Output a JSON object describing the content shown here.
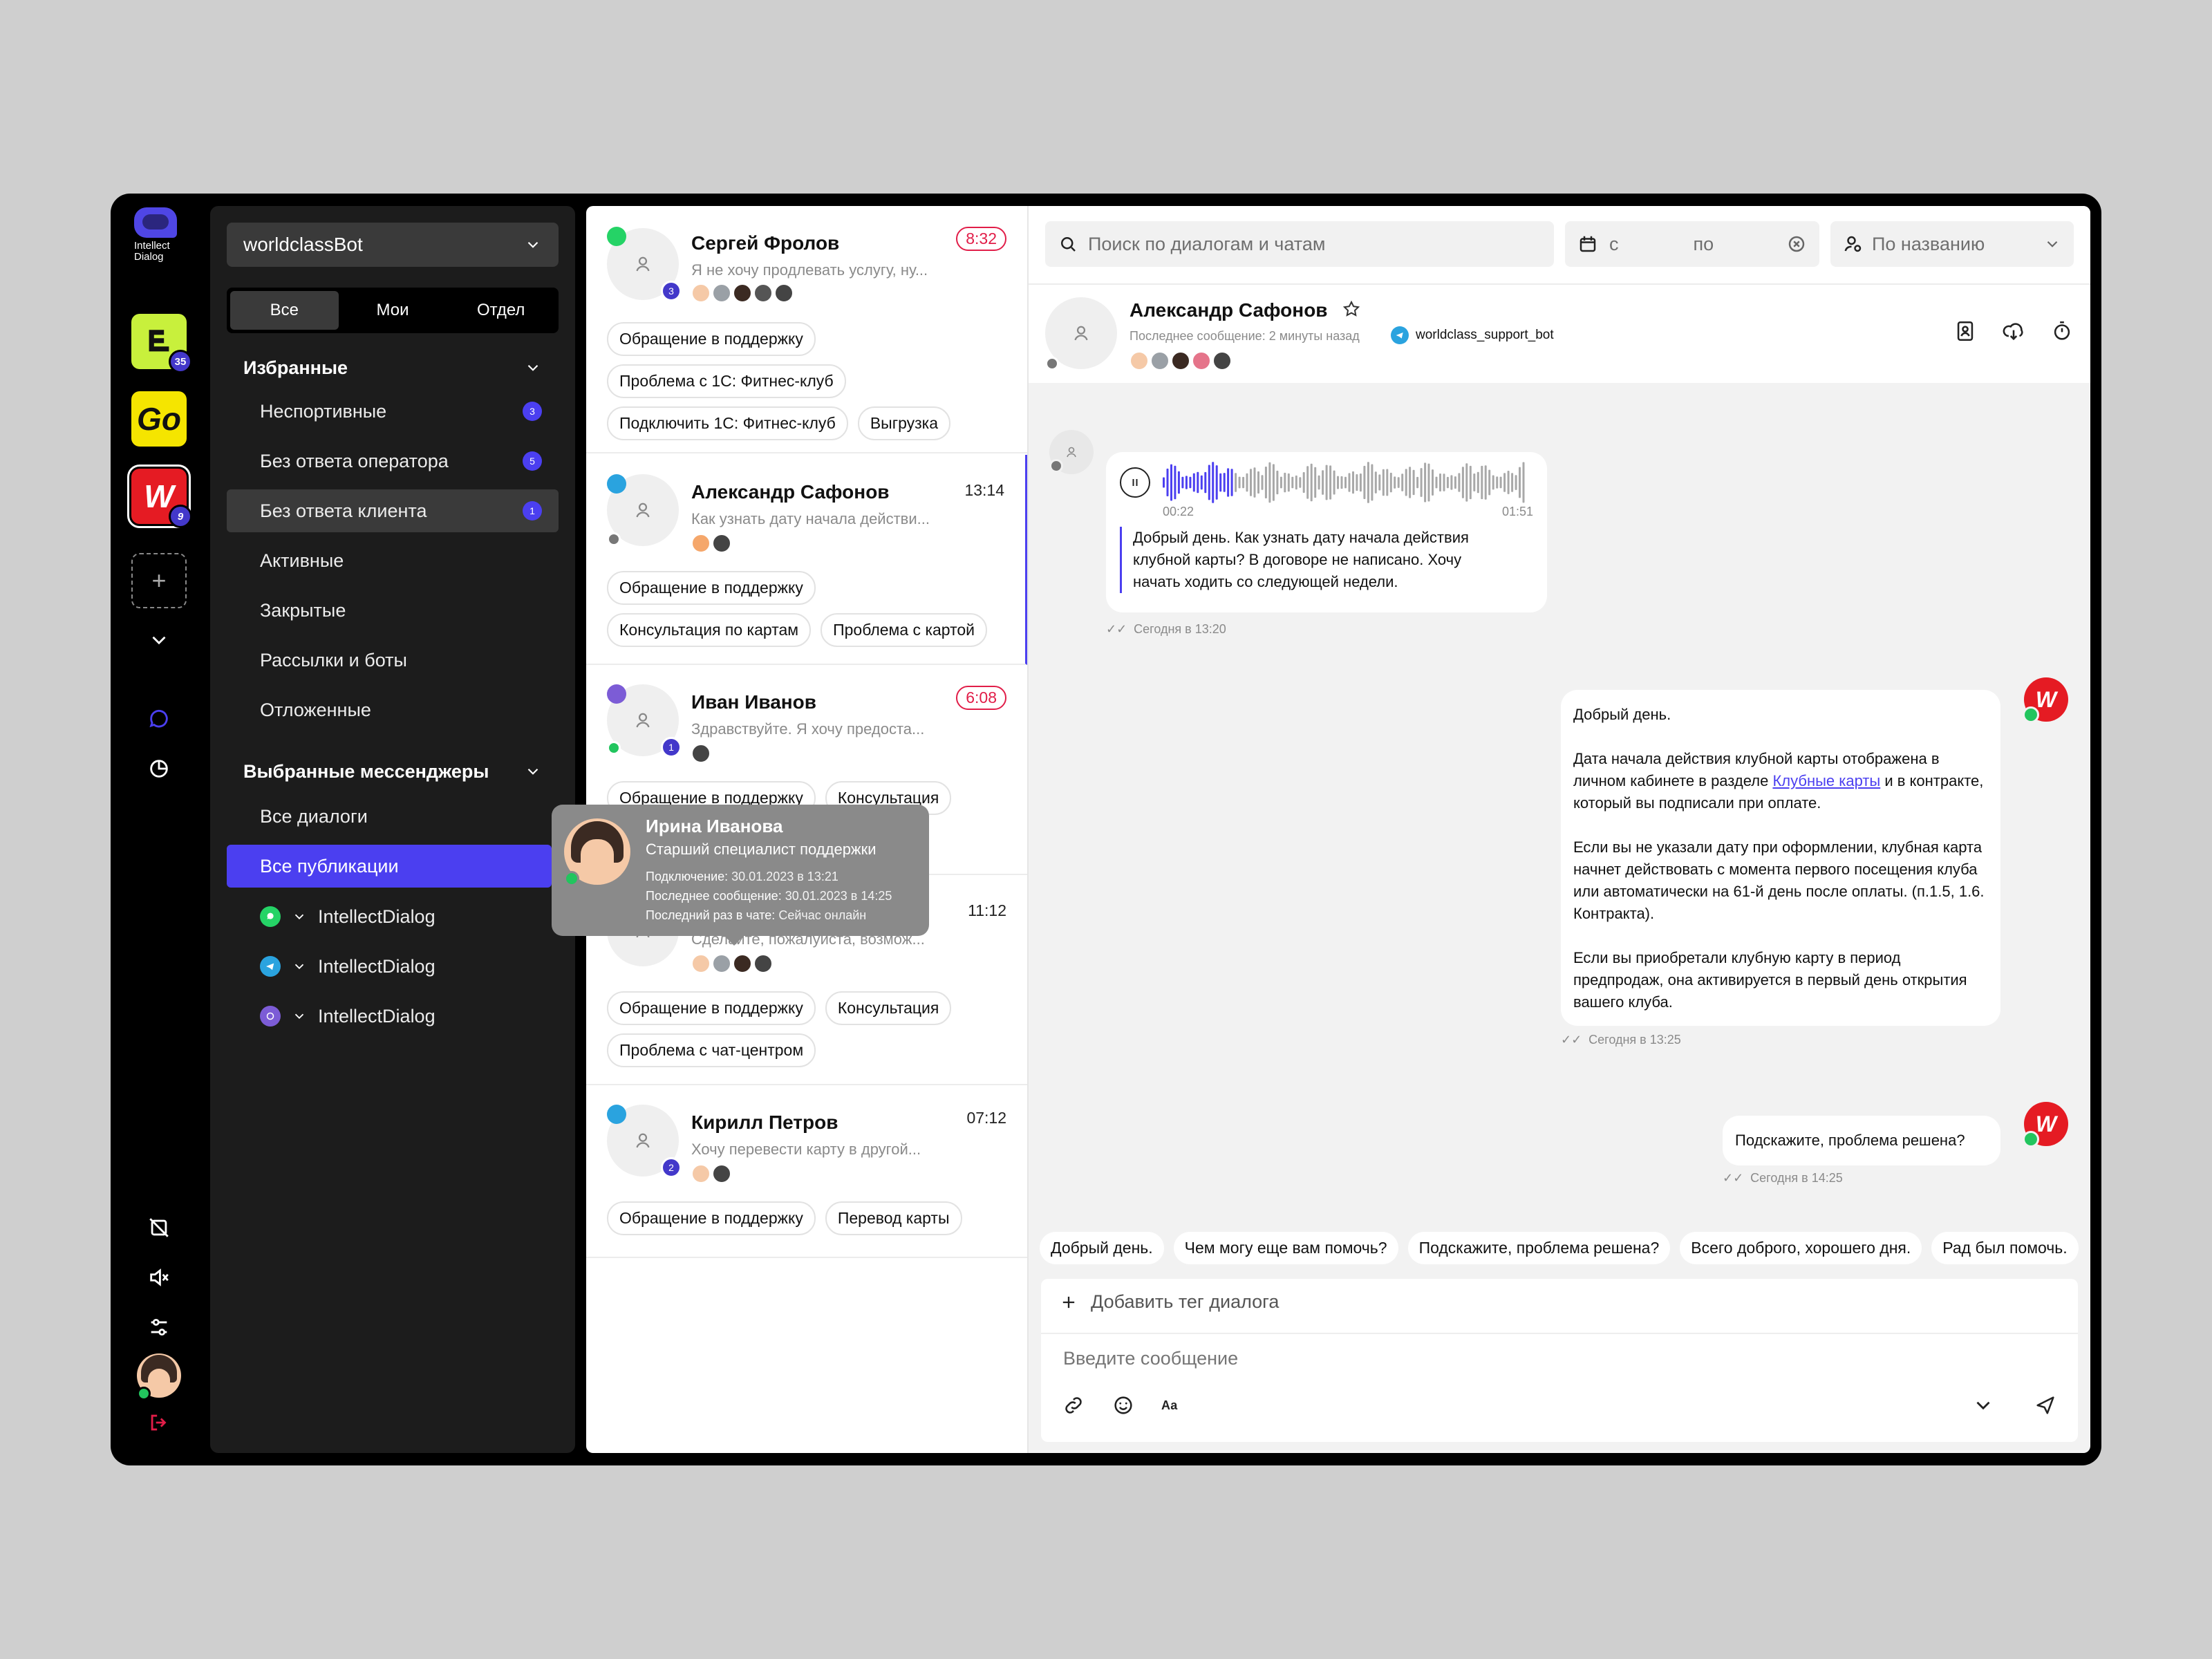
{
  "brand": {
    "line1": "Intellect",
    "line2": "Dialog"
  },
  "apps": [
    {
      "name": "app-1",
      "badge": "35",
      "color": "#c8f03c"
    },
    {
      "name": "go",
      "label": "Go",
      "color": "#f5e500"
    },
    {
      "name": "worldclass",
      "label": "W",
      "badge": "9",
      "color": "#e51b23"
    }
  ],
  "sidebar": {
    "bot": "worldclassBot",
    "scope_tabs": [
      "Все",
      "Мои",
      "Отдел"
    ],
    "favorites_title": "Избранные",
    "favorites": [
      {
        "label": "Неспортивные",
        "badge": "3"
      },
      {
        "label": "Без ответа оператора",
        "badge": "5"
      },
      {
        "label": "Без ответа клиента",
        "badge": "1"
      },
      {
        "label": "Активные"
      },
      {
        "label": "Закрытые"
      },
      {
        "label": "Рассылки и боты"
      },
      {
        "label": "Отложенные"
      }
    ],
    "messengers_title": "Выбранные мессенджеры",
    "messenger_views": [
      "Все диалоги",
      "Все публикации"
    ],
    "channels": [
      {
        "label": "IntellectDialog",
        "type": "whatsapp",
        "color": "#25d366"
      },
      {
        "label": "IntellectDialog",
        "type": "telegram",
        "color": "#2aa3df"
      },
      {
        "label": "IntellectDialog",
        "type": "viber",
        "color": "#7c5cd6"
      }
    ]
  },
  "dialogs": [
    {
      "name": "Сергей Фролов",
      "preview": "Я не хочу продлевать услугу, ну...",
      "time": "8:32",
      "urgent": true,
      "unread": "3",
      "source": "whatsapp",
      "tags": [
        "Обращение в поддержку",
        "Проблема с 1С: Фитнес-клуб",
        "Подключить 1С: Фитнес-клуб",
        "Выгрузка"
      ]
    },
    {
      "name": "Александр Сафонов",
      "preview": "Как узнать дату начала действи...",
      "time": "13:14",
      "urgent": false,
      "source": "telegram",
      "tags": [
        "Обращение в поддержку",
        "Консультация по картам",
        "Проблема с картой"
      ]
    },
    {
      "name": "Иван Иванов",
      "preview": "Здравствуйте. Я хочу предоста...",
      "time": "6:08",
      "urgent": true,
      "unread": "1",
      "source": "viber",
      "tags": [
        "Обращение в поддержку",
        "Консультация"
      ]
    },
    {
      "name": "",
      "preview": "Сделайте, пожалуйста, возмож...",
      "time": "11:12",
      "urgent": false,
      "tags": [
        "Обращение в поддержку",
        "Консультация",
        "Проблема с чат-центром"
      ]
    },
    {
      "name": "Кирилл Петров",
      "preview": "Хочу перевести карту в другой...",
      "time": "07:12",
      "urgent": false,
      "unread": "2",
      "source": "telegram",
      "tags": [
        "Обращение в поддержку",
        "Перевод карты"
      ]
    }
  ],
  "tooltip": {
    "name": "Ирина Иванова",
    "role": "Старший специалист поддержки",
    "connected_label": "Подключение:",
    "connected": "30.01.2023 в 13:21",
    "last_msg_label": "Последнее сообщение:",
    "last_msg": "30.01.2023 в 14:25",
    "last_seen_label": "Последний раз в чате:",
    "last_seen": "Сейчас онлайн"
  },
  "toolbar": {
    "search_placeholder": "Поиск по диалогам и чатам",
    "date_from": "с",
    "date_to": "по",
    "sort": "По названию"
  },
  "chat": {
    "name": "Александр Сафонов",
    "last_message": "Последнее сообщение: 2 минуты назад",
    "bot": "worldclass_support_bot",
    "voice": {
      "elapsed": "00:22",
      "total": "01:51",
      "progress": 0.2
    },
    "client_text": "Добрый день. Как узнать дату начала действия клубной карты? В договоре не написано. Хочу начать ходить со следующей недели.",
    "client_time": "Сегодня в 13:20",
    "reply_greeting": "Добрый день.",
    "reply_p1_before": "Дата начала действия клубной карты отображена в личном кабинете в разделе ",
    "reply_p1_link": "Клубные карты",
    "reply_p1_after": " и в контракте, который вы подписали при оплате.",
    "reply_p2": "Если вы не указали дату при оформлении, клубная карта начнет действовать с момента первого посещения клуба или автоматически на 61-й день после оплаты. (п.1.5, 1.6. Контракта).",
    "reply_p3": "Если вы приобретали клубную карту в период предпродаж, она активируется в первый день открытия вашего клуба.",
    "reply_time": "Сегодня в 13:25",
    "followup": "Подскажите, проблема решена?",
    "followup_time": "Сегодня в 14:25"
  },
  "quick_replies": [
    "Добрый день.",
    "Чем могу еще вам помочь?",
    "Подскажите, проблема решена?",
    "Всего доброго, хорошего дня.",
    "Рад был помочь."
  ],
  "composer": {
    "add_tag": "Добавить тег диалога",
    "placeholder": "Введите сообщение",
    "format": "Аа"
  },
  "colors": {
    "accent": "#4b3ff0",
    "urgent": "#e11d48",
    "online": "#22c55e",
    "brand_red": "#e51b23"
  }
}
